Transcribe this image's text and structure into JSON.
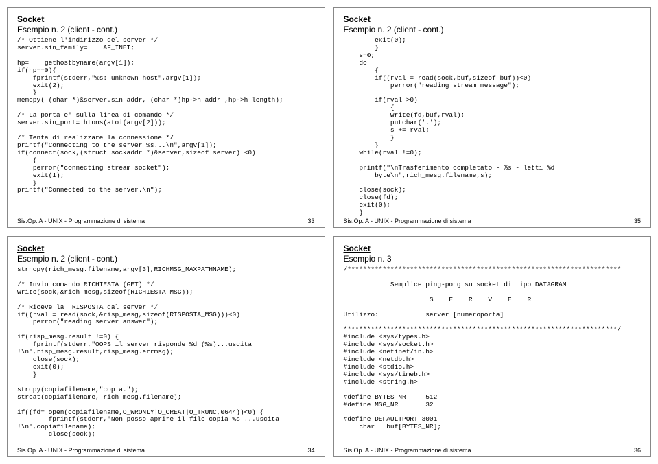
{
  "slides": [
    {
      "title": "Socket",
      "subtitle": "Esempio n. 2 (client - cont.)",
      "code": "/* Ottiene l'indirizzo del server */\nserver.sin_family=    AF_INET;\n\nhp=    gethostbyname(argv[1]);\nif(hp==0){\n    fprintf(stderr,\"%s: unknown host\",argv[1]);\n    exit(2);\n    }\nmemcpy( (char *)&server.sin_addr, (char *)hp->h_addr ,hp->h_length);\n\n/* La porta e' sulla linea di comando */\nserver.sin_port= htons(atoi(argv[2]));\n\n/* Tenta di realizzare la connessione */\nprintf(\"Connecting to the server %s...\\n\",argv[1]);\nif(connect(sock,(struct sockaddr *)&server,sizeof server) <0)\n    {\n    perror(\"connecting stream socket\");\n    exit(1);\n    }\nprintf(\"Connected to the server.\\n\");",
      "footer": "Sis.Op. A - UNIX - Programmazione di sistema",
      "page": "33"
    },
    {
      "title": "Socket",
      "subtitle": "Esempio n. 2 (client - cont.)",
      "code": "        exit(0);\n        }\n    s=0;\n    do\n        {\n        if((rval = read(sock,buf,sizeof buf))<0)\n            perror(\"reading stream message\");\n\n        if(rval >0)\n            {\n            write(fd,buf,rval);\n            putchar('.');\n            s += rval;\n            }\n        }\n    while(rval !=0);\n\n    printf(\"\\nTrasferimento completato - %s - letti %d\n        byte\\n\",rich_mesg.filename,s);\n\n    close(sock);\n    close(fd);\n    exit(0);\n    }",
      "footer": "Sis.Op. A - UNIX - Programmazione di sistema",
      "page": "35"
    },
    {
      "title": "Socket",
      "subtitle": "Esempio n. 2 (client - cont.)",
      "code": "strncpy(rich_mesg.filename,argv[3],RICHMSG_MAXPATHNAME);\n\n/* Invio comando RICHIESTA (GET) */\nwrite(sock,&rich_mesg,sizeof(RICHIESTA_MSG));\n\n/* Riceve la  RISPOSTA dal server */\nif((rval = read(sock,&risp_mesg,sizeof(RISPOSTA_MSG)))<0)\n    perror(\"reading server answer\");\n\nif(risp_mesg.result !=0) {\n    fprintf(stderr,\"OOPS il server risponde %d (%s)...uscita\n!\\n\",risp_mesg.result,risp_mesg.errmsg);\n    close(sock);\n    exit(0);\n    }\n\nstrcpy(copiafilename,\"copia.\");\nstrcat(copiafilename, rich_mesg.filename);\n\nif((fd= open(copiafilename,O_WRONLY|O_CREAT|O_TRUNC,0644))<0) {\n        fprintf(stderr,\"Non posso aprire il file copia %s ...uscita\n!\\n\",copiafilename);\n        close(sock);",
      "footer": "Sis.Op. A - UNIX - Programmazione di sistema",
      "page": "34"
    },
    {
      "title": "Socket",
      "subtitle": "Esempio n. 3",
      "code": "/**********************************************************************\n\n            Semplice ping-pong su socket di tipo DATAGRAM\n\n                      S    E    R    V    E    R\n\nUtilizzo:            server [numeroporta]\n\n**********************************************************************/\n#include <sys/types.h>\n#include <sys/socket.h>\n#include <netinet/in.h>\n#include <netdb.h>\n#include <stdio.h>\n#include <sys/timeb.h>\n#include <string.h>\n\n#define BYTES_NR     512\n#define MSG_NR       32\n\n#define DEFAULTPORT 3001\n    char   buf[BYTES_NR];",
      "footer": "Sis.Op. A - UNIX - Programmazione di sistema",
      "page": "36"
    }
  ]
}
